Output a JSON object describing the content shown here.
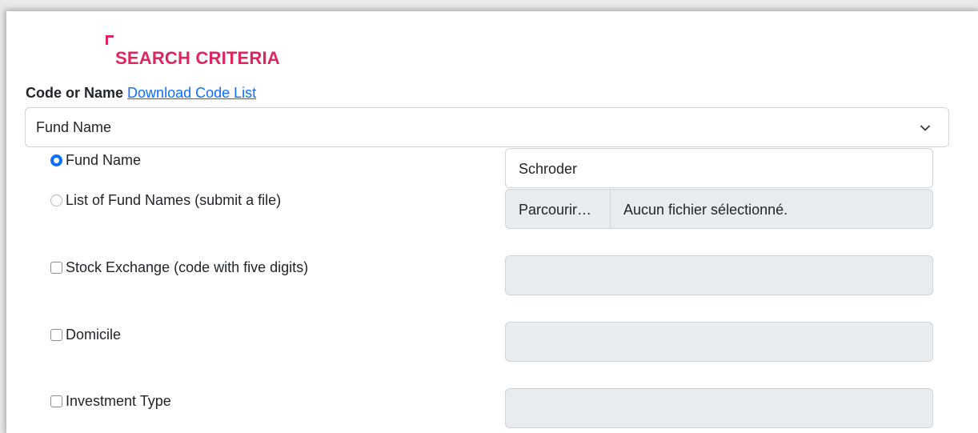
{
  "section": {
    "title": "SEARCH CRITERIA",
    "accent_color": "#e0245e"
  },
  "code_or_name": {
    "label": "Code or Name",
    "download_link": "Download Code List",
    "select_value": "Fund Name"
  },
  "options": [
    {
      "label": "Fund Name",
      "type": "radio",
      "checked": true
    },
    {
      "label": "List of Fund Names (submit a file)",
      "type": "radio",
      "checked": false
    },
    {
      "label": "Stock Exchange (code with five digits)",
      "type": "checkbox",
      "checked": false
    },
    {
      "label": "Domicile",
      "type": "checkbox",
      "checked": false
    },
    {
      "label": "Investment Type",
      "type": "checkbox",
      "checked": false
    }
  ],
  "fund_name_input": {
    "value": "Schroder"
  },
  "file_input": {
    "browse_label": "Parcourir…",
    "status": "Aucun fichier sélectionné."
  },
  "stock_exchange_input": {
    "value": ""
  },
  "domicile_input": {
    "value": ""
  },
  "investment_type_input": {
    "value": ""
  }
}
